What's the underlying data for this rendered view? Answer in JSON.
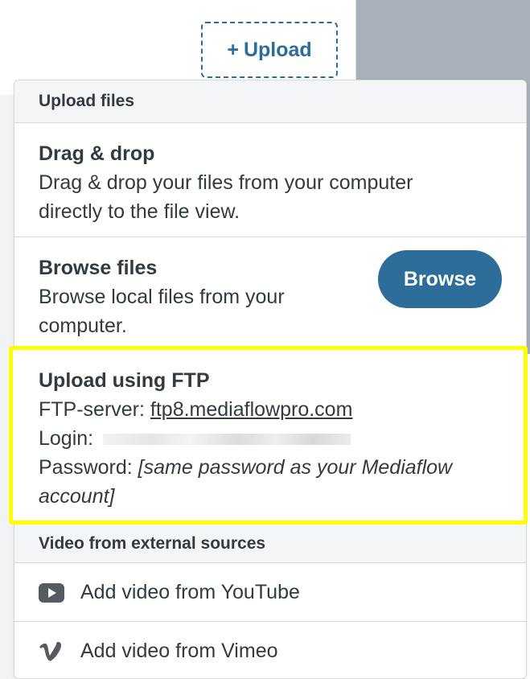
{
  "toolbar": {
    "upload_label": "Upload",
    "upload_plus": "+"
  },
  "menu": {
    "header": "Upload files",
    "drag_drop": {
      "title": "Drag & drop",
      "desc": "Drag & drop your files from your computer directly to the file view."
    },
    "browse": {
      "title": "Browse files",
      "desc": "Browse local files from your computer.",
      "button": "Browse"
    },
    "ftp": {
      "title": "Upload using FTP",
      "server_label": "FTP-server:",
      "server_value": "ftp8.mediaflowpro.com",
      "login_label": "Login:",
      "password_label": "Password:",
      "password_value": "[same password as your Mediaflow account]",
      "highlight_color": "#ffff00"
    },
    "video_header": "Video from external sources",
    "youtube_label": "Add video from YouTube",
    "youtube_icon": "youtube-icon",
    "vimeo_label": "Add video from Vimeo",
    "vimeo_icon": "vimeo-icon"
  },
  "colors": {
    "accent": "#2c6e99",
    "text": "#333a40"
  }
}
